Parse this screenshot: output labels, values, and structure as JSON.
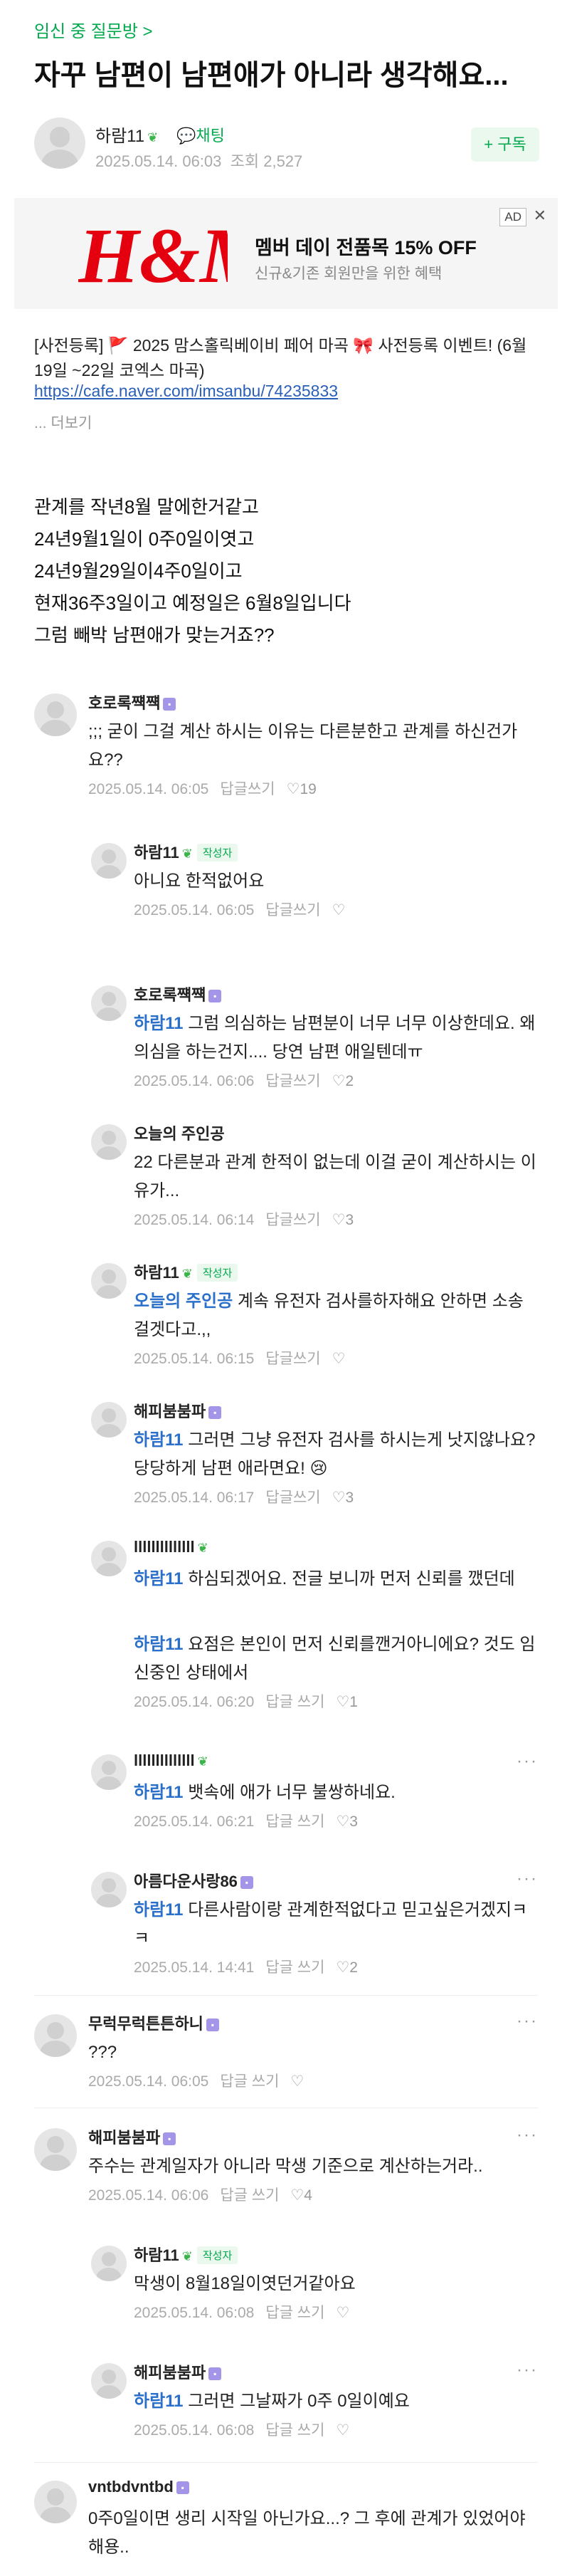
{
  "header": {
    "board_link": "임신 중 질문방 >",
    "title": "자꾸 남편이 남편애가 아니라 생각해요...",
    "author": "하람11",
    "chat_label": "채팅",
    "date": "2025.05.14. 06:03",
    "views_label": "조회 2,527",
    "subscribe_label": "+ 구독"
  },
  "ad": {
    "logo_text": "H&M",
    "title": "멤버 데이 전품목 15% OFF",
    "desc": "신규&기존 회원만을 위한 혜택",
    "badge": "AD",
    "close": "✕"
  },
  "notice": {
    "text": "[사전등록] 🚩 2025 맘스홀릭베이비 페어 마곡 🎀 사전등록 이벤트! (6월 19일 ~22일 코엑스 마곡)",
    "link": "https://cafe.naver.com/imsanbu/74235833",
    "more": "... 더보기"
  },
  "post_body": [
    "관계를 작년8월 말에한거같고",
    "24년9월1일이 0주0일이엿고",
    "24년9월29일이4주0일이고",
    "현재36주3일이고 예정일은 6월8일입니다",
    "그럼 빼박 남편애가 맞는거죠??"
  ],
  "comment_meta": {
    "reply_label_1": "답글쓰기",
    "reply_label_2": "답글 쓰기"
  },
  "comments": [
    {
      "name": "호로록쨱쨱",
      "text": ";;; 굳이 그걸 계산 하시는 이유는 다른분한고 관계를 하신건가요??",
      "date": "2025.05.14. 06:05",
      "likes": "19"
    },
    {
      "name": "하람11",
      "writer": "작성자",
      "text": "아니요 한적없어요",
      "date": "2025.05.14. 06:05",
      "likes": ""
    },
    {
      "name": "호로록쨱쨱",
      "mention": "하람11",
      "text": "그럼 의심하는 남편분이 너무 너무 이상한데요. 왜 의심을 하는건지.... 당연 남편 애일텐데ㅠ",
      "date": "2025.05.14. 06:06",
      "likes": "2"
    },
    {
      "name": "오늘의 주인공",
      "text": "22 다른분과 관계 한적이 없는데 이걸 굳이 계산하시는 이유가...",
      "date": "2025.05.14. 06:14",
      "likes": "3"
    },
    {
      "name": "하람11",
      "writer": "작성자",
      "mention": "오늘의 주인공",
      "text": "계속 유전자 검사를하자해요 안하면 소송 걸겟다고.,,",
      "date": "2025.05.14. 06:15",
      "likes": ""
    },
    {
      "name": "해피붐붐파",
      "mention": "하람11",
      "text": "그러면 그냥 유전자 검사를 하시는게 낫지않나요? 당당하게 남편 애라면요! 😢",
      "date": "2025.05.14. 06:17",
      "likes": "3"
    },
    {
      "name": "llllllllllllll",
      "mention": "하람11",
      "text": "하심되겠어요. 전글 보니까 먼저 신뢰를 깼던데",
      "date": "",
      "likes": ""
    },
    {
      "name": "",
      "mention": "하람11",
      "text": "요점은 본인이 먼저 신뢰를깬거아니에요? 것도 임신중인 상태에서",
      "date": "2025.05.14. 06:20",
      "likes": "1"
    },
    {
      "name": "llllllllllllll",
      "mention": "하람11",
      "text": "뱃속에 애가 너무 불쌍하네요.",
      "date": "2025.05.14. 06:21",
      "likes": "3"
    },
    {
      "name": "아름다운사랑86",
      "mention": "하람11",
      "text": "다른사람이랑 관계한적없다고 믿고싶은거겠지ㅋㅋ",
      "date": "2025.05.14. 14:41",
      "likes": "2"
    },
    {
      "name": "무럭무럭튼튼하니",
      "text": "???",
      "date": "2025.05.14. 06:05",
      "likes": ""
    },
    {
      "name": "해피붐붐파",
      "text": "주수는 관계일자가 아니라 막생 기준으로 계산하는거라..",
      "date": "2025.05.14. 06:06",
      "likes": "4"
    },
    {
      "name": "하람11",
      "writer": "작성자",
      "text": "막생이 8월18일이엿던거같아요",
      "date": "2025.05.14. 06:08",
      "likes": ""
    },
    {
      "name": "해피붐붐파",
      "mention": "하람11",
      "text": "그러면 그날짜가 0주 0일이예요",
      "date": "2025.05.14. 06:08",
      "likes": ""
    },
    {
      "name": "vntbdvntbd",
      "text": "0주0일이면 생리 시작일 아닌가요...? 그 후에 관계가 있었어야해용..",
      "date": "",
      "likes": ""
    }
  ]
}
